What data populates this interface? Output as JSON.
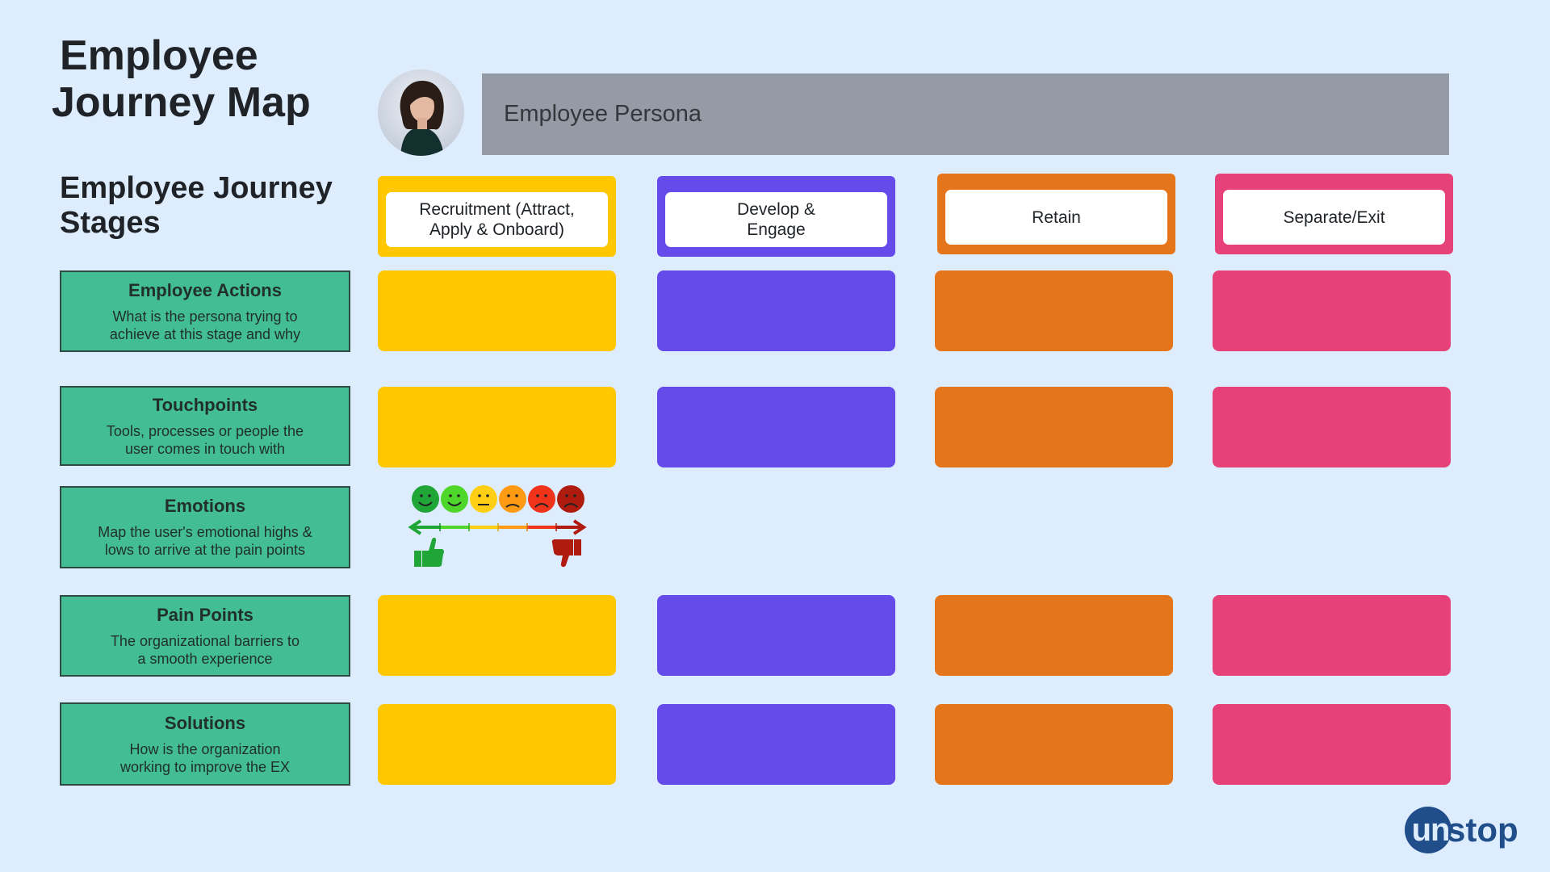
{
  "header": {
    "title_line1": "Employee",
    "title_line2": "Journey Map",
    "stages_heading_line1": "Employee Journey",
    "stages_heading_line2": "Stages",
    "persona_label": "Employee Persona"
  },
  "stages": [
    {
      "line1": "Recruitment (Attract,",
      "line2": "Apply & Onboard)",
      "color": "#ffc700"
    },
    {
      "line1": "Develop &",
      "line2": "Engage",
      "color": "#654bea"
    },
    {
      "line1": "Retain",
      "line2": "",
      "color": "#e5751b"
    },
    {
      "line1": "Separate/Exit",
      "line2": "",
      "color": "#e7417a"
    }
  ],
  "rows": [
    {
      "title": "Employee Actions",
      "desc1": "What is the persona trying to",
      "desc2": "achieve at this stage and why"
    },
    {
      "title": "Touchpoints",
      "desc1": "Tools, processes or people the",
      "desc2": "user comes in touch with"
    },
    {
      "title": "Emotions",
      "desc1": "Map the user's emotional highs &",
      "desc2": "lows to arrive at the pain points"
    },
    {
      "title": "Pain Points",
      "desc1": "The organizational barriers to",
      "desc2": "a smooth experience"
    },
    {
      "title": "Solutions",
      "desc1": "How is the organization",
      "desc2": "working to improve the EX"
    }
  ],
  "emotion_scale": {
    "faces": [
      "very-happy",
      "happy",
      "neutral",
      "slightly-sad",
      "sad",
      "angry"
    ],
    "face_colors": [
      "#1fa637",
      "#4fd62b",
      "#ffcf16",
      "#ff9b12",
      "#f0341c",
      "#b01b10"
    ],
    "left_icon": "thumbs-up-icon",
    "right_icon": "thumbs-down-icon"
  },
  "logo": {
    "circle_text": "un",
    "rest_text": "stop"
  },
  "colors": {
    "background": "#deedfe",
    "label_fill": "#43bd94",
    "persona_fill": "#949ba5",
    "brand": "#1f4e8b"
  }
}
